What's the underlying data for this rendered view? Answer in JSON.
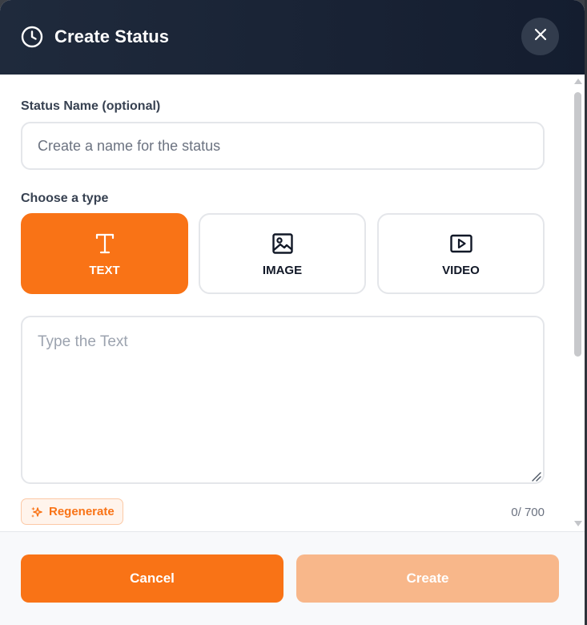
{
  "header": {
    "title": "Create Status",
    "icon": "clock-icon",
    "close_icon": "close-icon"
  },
  "status_name": {
    "label": "Status Name (optional)",
    "placeholder": "Create a name for the status",
    "value": ""
  },
  "type_section": {
    "label": "Choose a type",
    "options": [
      {
        "label": "TEXT",
        "icon": "text-type-icon",
        "selected": true
      },
      {
        "label": "IMAGE",
        "icon": "image-icon",
        "selected": false
      },
      {
        "label": "VIDEO",
        "icon": "video-play-icon",
        "selected": false
      }
    ]
  },
  "text_input": {
    "placeholder": "Type the Text",
    "value": ""
  },
  "regenerate": {
    "label": "Regenerate",
    "icon": "sparkles-icon"
  },
  "counter": "0/ 700",
  "footer": {
    "cancel_label": "Cancel",
    "create_label": "Create",
    "create_enabled": false
  },
  "colors": {
    "accent": "#f97316",
    "accent_disabled": "#f8b78a",
    "header_bg": "#1a2335"
  }
}
